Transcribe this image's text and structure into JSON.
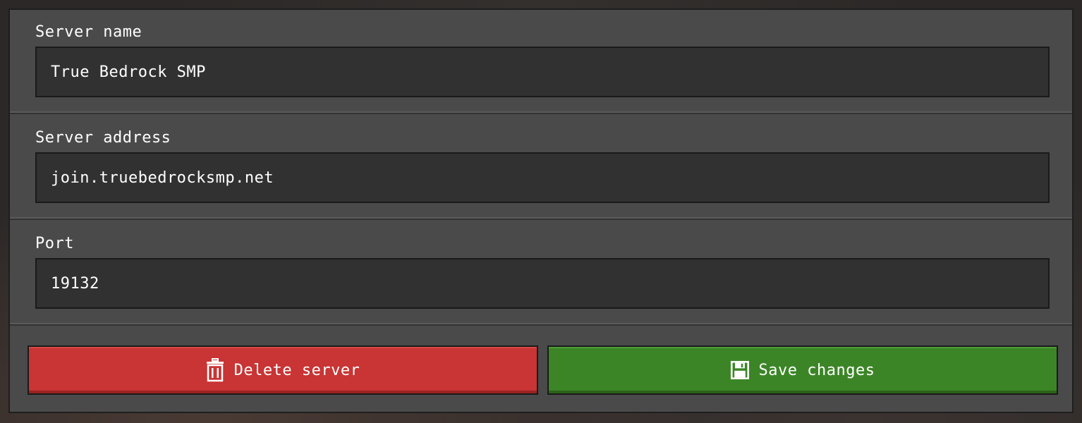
{
  "form": {
    "server_name": {
      "label": "Server name",
      "value": "True Bedrock SMP"
    },
    "server_address": {
      "label": "Server address",
      "value": "join.truebedrocksmp.net"
    },
    "port": {
      "label": "Port",
      "value": "19132"
    }
  },
  "actions": {
    "delete": {
      "label": "Delete server",
      "icon": "trash-icon",
      "color": "#c93434"
    },
    "save": {
      "label": "Save changes",
      "icon": "floppy-disk-icon",
      "color": "#3c8527"
    }
  },
  "colors": {
    "panel": "#4a4a4a",
    "input_bg": "#313131",
    "text": "#ffffff"
  }
}
